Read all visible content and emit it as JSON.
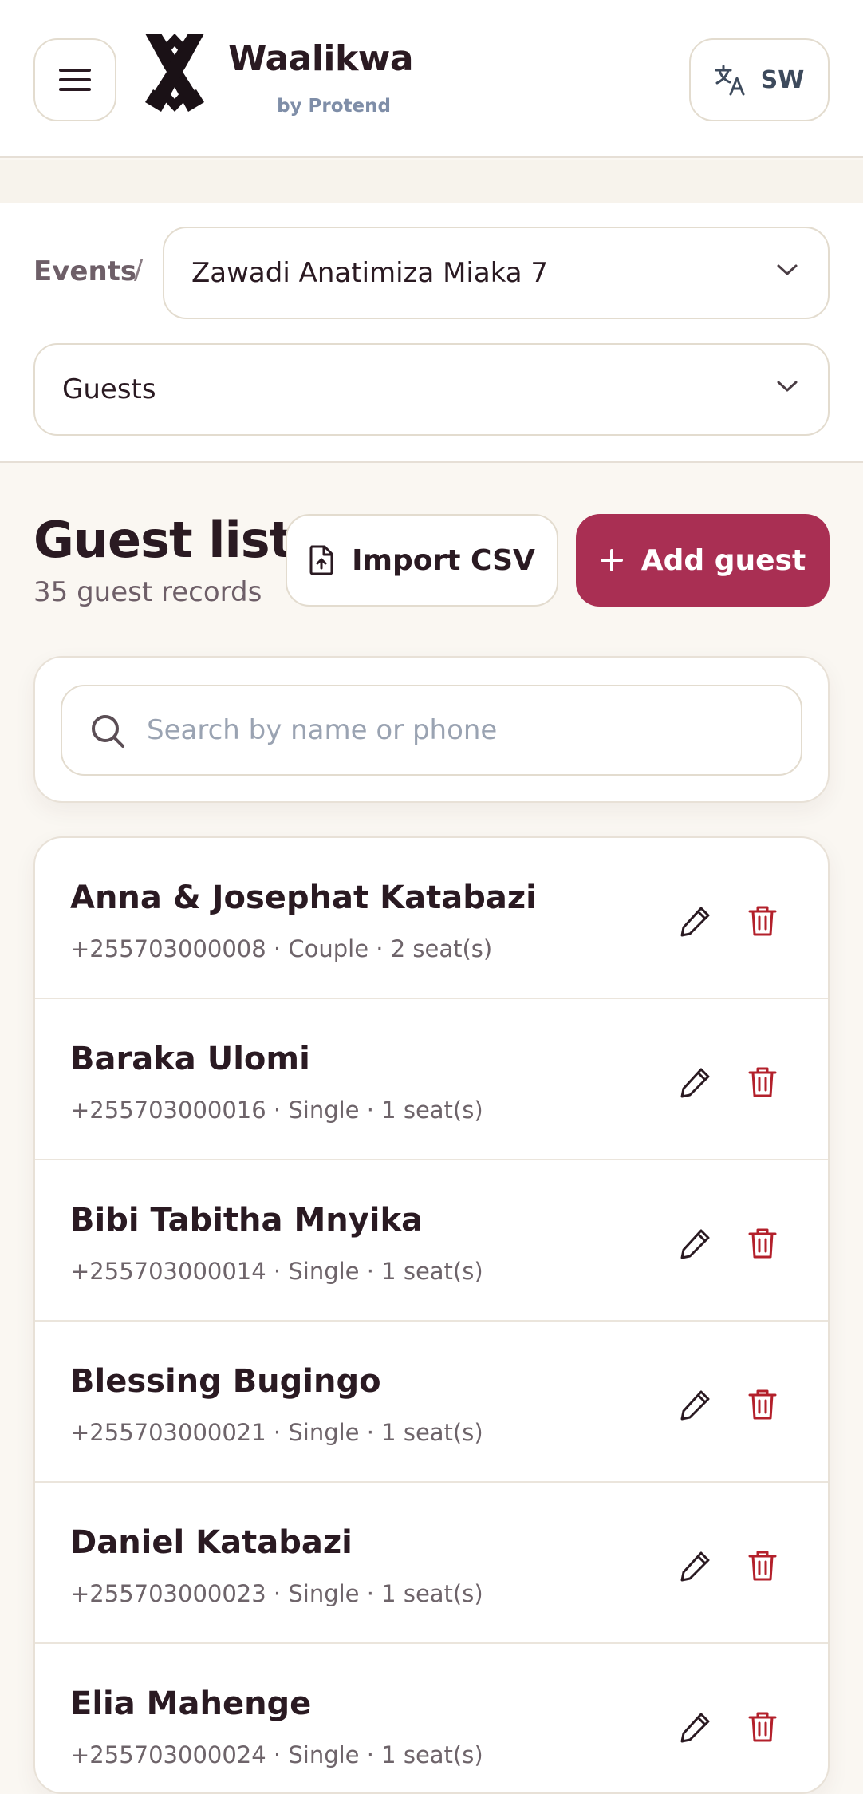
{
  "header": {
    "brand_name": "Waalikwa",
    "brand_by": "by Protend",
    "language_label": "SW"
  },
  "context": {
    "breadcrumb_root": "Events",
    "breadcrumb_sep": "/",
    "event_selected": "Zawadi Anatimiza Miaka 7",
    "section_selected": "Guests"
  },
  "page": {
    "title": "Guest list",
    "subtitle": "35 guest records",
    "import_label": "Import CSV",
    "add_label": "Add guest"
  },
  "search": {
    "placeholder": "Search by name or phone",
    "value": ""
  },
  "guests": [
    {
      "name": "Anna & Josephat Katabazi",
      "meta": "+255703000008 · Couple · 2 seat(s)"
    },
    {
      "name": "Baraka Ulomi",
      "meta": "+255703000016 · Single · 1 seat(s)"
    },
    {
      "name": "Bibi Tabitha Mnyika",
      "meta": "+255703000014 · Single · 1 seat(s)"
    },
    {
      "name": "Blessing Bugingo",
      "meta": "+255703000021 · Single · 1 seat(s)"
    },
    {
      "name": "Daniel Katabazi",
      "meta": "+255703000023 · Single · 1 seat(s)"
    },
    {
      "name": "Elia Mahenge",
      "meta": "+255703000024 · Single · 1 seat(s)"
    }
  ],
  "colors": {
    "accent": "#a92f53",
    "delete": "#b3202b",
    "background": "#faf7f2"
  }
}
